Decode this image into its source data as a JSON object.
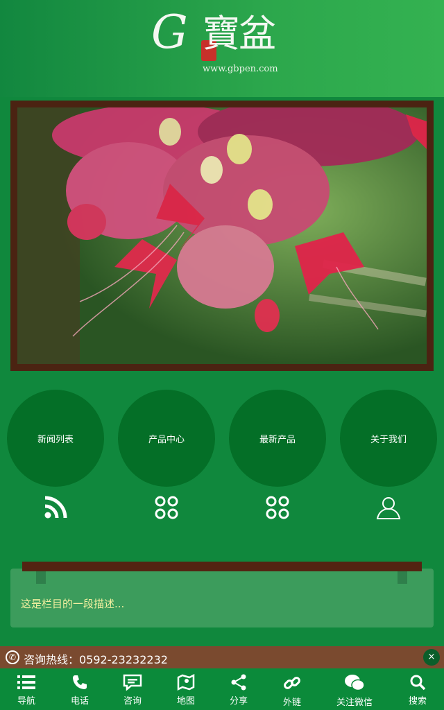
{
  "logo": {
    "letter": "G",
    "brand": "寶盆",
    "url": "www.gbpen.com"
  },
  "banner": {
    "alt": "flower-photo"
  },
  "nav_circles": [
    {
      "label": "新闻列表",
      "icon": "rss-icon"
    },
    {
      "label": "产品中心",
      "icon": "grid-icon"
    },
    {
      "label": "最新产品",
      "icon": "grid-icon"
    },
    {
      "label": "关于我们",
      "icon": "user-icon"
    }
  ],
  "section": {
    "description": "这是栏目的一段描述..."
  },
  "hotline": {
    "text": "咨询热线：0592-23232232"
  },
  "close_label": "×",
  "tabbar": [
    {
      "label": "导航",
      "icon": "menu-icon"
    },
    {
      "label": "电话",
      "icon": "phone-icon"
    },
    {
      "label": "咨询",
      "icon": "chat-icon"
    },
    {
      "label": "地图",
      "icon": "map-icon"
    },
    {
      "label": "分享",
      "icon": "share-icon"
    },
    {
      "label": "外链",
      "icon": "link-icon"
    },
    {
      "label": "关注微信",
      "icon": "wechat-icon"
    },
    {
      "label": "搜索",
      "icon": "search-icon"
    }
  ],
  "colors": {
    "background": "#10883d",
    "circle": "#046f27",
    "frame": "#4b2312",
    "hotline": "#7a4a2f",
    "description_text": "#f3f0a0"
  }
}
